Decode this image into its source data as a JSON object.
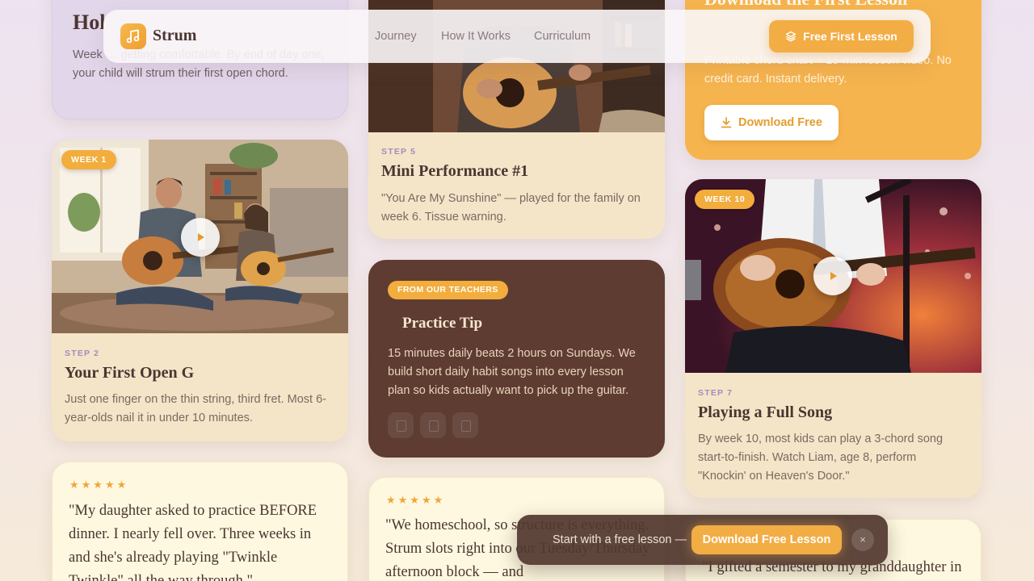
{
  "nav": {
    "logo_text": "Strum",
    "links": [
      "Journey",
      "How It Works",
      "Curriculum"
    ],
    "cta_label": "Free First Lesson"
  },
  "cards": {
    "intro": {
      "title_partial": "Hol",
      "body": "Week … getting comfortable. By end of day one, your child will strum their first open chord."
    },
    "week1": {
      "badge": "WEEK 1",
      "step": "STEP 2",
      "title": "Your First Open G",
      "body": "Just one finger on the thin string, third fret. Most 6-year-olds nail it in under 10 minutes."
    },
    "step5": {
      "step": "STEP 5",
      "title": "Mini Performance #1",
      "body": "\"You Are My Sunshine\" — played for the family on week 6. Tissue warning."
    },
    "tip": {
      "pill": "FROM OUR TEACHERS",
      "title": "Practice Tip",
      "body": "15 minutes daily beats 2 hours on Sundays. We build short daily habit songs into every lesson plan so kids actually want to pick up the guitar."
    },
    "download": {
      "title": "Download the First Lesson",
      "body": "Printable chord chart + 15-min lesson video. No credit card. Instant delivery.",
      "button": "Download Free"
    },
    "week10": {
      "badge": "WEEK 10",
      "step": "STEP 7",
      "title": "Playing a Full Song",
      "body": "By week 10, most kids can play a 3-chord song start-to-finish. Watch Liam, age 8, perform \"Knockin' on Heaven's Door.\""
    }
  },
  "testimonials": [
    {
      "stars": "★★★★★",
      "quote": "\"My daughter asked to practice BEFORE dinner. I nearly fell over. Three weeks in and she's already playing \"Twinkle Twinkle\" all the way through.\""
    },
    {
      "stars": "★★★★★",
      "quote": "\"We homeschool, so structure is everything. Strum slots right into our Tuesday/Thursday afternoon block — and"
    },
    {
      "stars": "",
      "quote": "\"I gifted a semester to my granddaughter in"
    }
  ],
  "sticky": {
    "text": "Start with a free lesson —",
    "button": "Download Free Lesson",
    "close": "×"
  },
  "colors": {
    "accent": "#f3ad45",
    "brown": "#5e3c32",
    "cream": "#f4e5c8",
    "lavender": "#e2d6ea"
  },
  "icons": {
    "logo": "music-note-icon",
    "cta": "layers-icon",
    "download": "download-icon",
    "video": "play-icon",
    "close": "close-icon"
  }
}
